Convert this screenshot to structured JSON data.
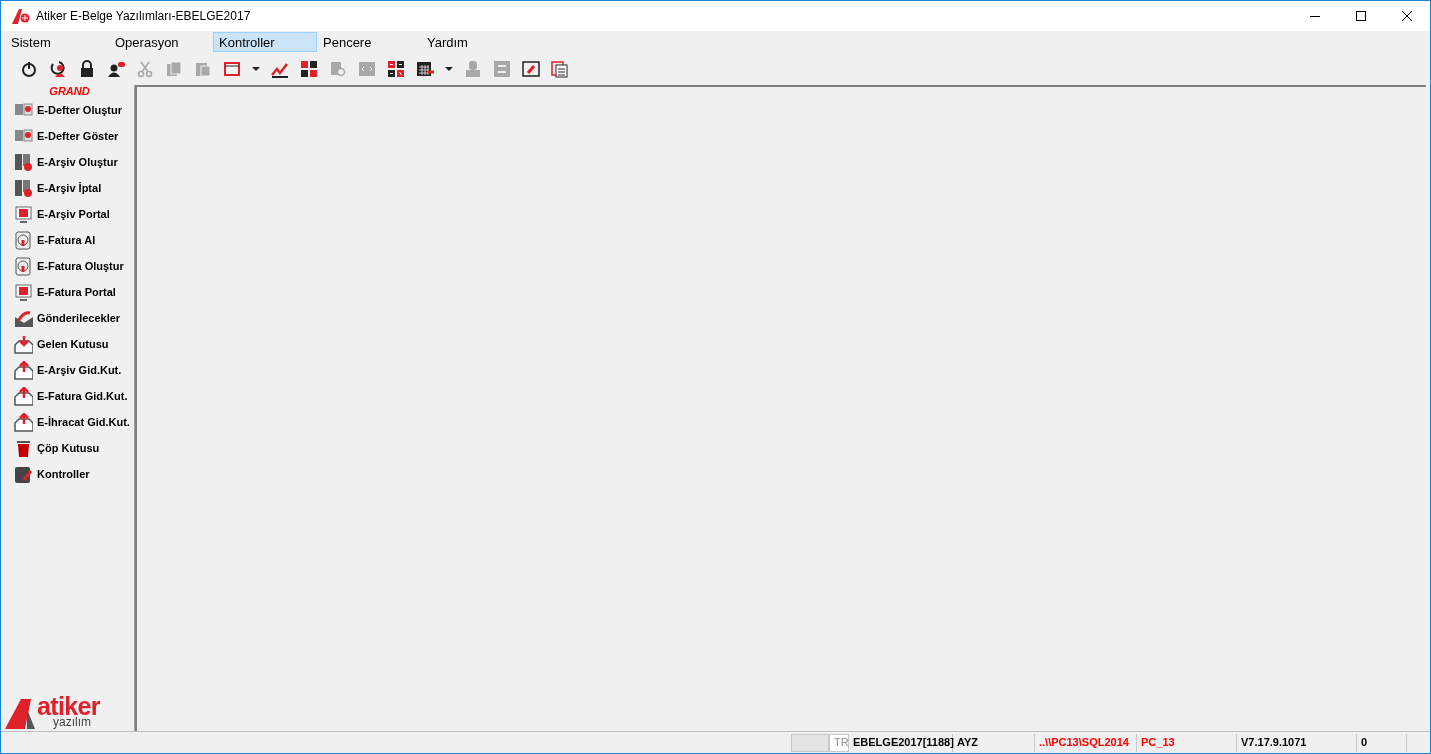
{
  "window": {
    "title": "Atiker E-Belge Yazılımları-EBELGE2017"
  },
  "menu": [
    {
      "label": "Sistem",
      "selected": false
    },
    {
      "label": "Operasyon",
      "selected": false
    },
    {
      "label": "Kontroller",
      "selected": true
    },
    {
      "label": "Pencere",
      "selected": false
    },
    {
      "label": "Yardım",
      "selected": false
    }
  ],
  "toolbar": [
    {
      "kind": "power",
      "disabled": false
    },
    {
      "kind": "logout",
      "disabled": false
    },
    {
      "kind": "lock",
      "disabled": false
    },
    {
      "kind": "user",
      "disabled": false
    },
    {
      "kind": "cut",
      "disabled": true
    },
    {
      "kind": "copy",
      "disabled": true
    },
    {
      "kind": "paste",
      "disabled": true
    },
    {
      "kind": "window",
      "disabled": false
    },
    {
      "kind": "dropdown",
      "disabled": false
    },
    {
      "kind": "chart",
      "disabled": false
    },
    {
      "kind": "tiles",
      "disabled": false
    },
    {
      "kind": "search",
      "disabled": true
    },
    {
      "kind": "code",
      "disabled": true
    },
    {
      "kind": "calc",
      "disabled": false
    },
    {
      "kind": "calendar",
      "disabled": false
    },
    {
      "kind": "dropdown",
      "disabled": false
    },
    {
      "kind": "stamp",
      "disabled": true
    },
    {
      "kind": "swap",
      "disabled": true
    },
    {
      "kind": "edit",
      "disabled": false
    },
    {
      "kind": "clipboard",
      "disabled": false
    }
  ],
  "sidebar": {
    "heading": "GRAND",
    "items": [
      {
        "label": "E-Defter Oluştur",
        "kind": "ledger"
      },
      {
        "label": "E-Defter Göster",
        "kind": "ledger"
      },
      {
        "label": "E-Arşiv Oluştur",
        "kind": "archive"
      },
      {
        "label": "E-Arşiv İptal",
        "kind": "archive"
      },
      {
        "label": "E-Arşiv Portal",
        "kind": "monitor"
      },
      {
        "label": "E-Fatura Al",
        "kind": "globe"
      },
      {
        "label": "E-Fatura Oluştur",
        "kind": "globe"
      },
      {
        "label": "E-Fatura Portal",
        "kind": "monitor"
      },
      {
        "label": "Gönderilecekler",
        "kind": "send"
      },
      {
        "label": "Gelen Kutusu",
        "kind": "inbox"
      },
      {
        "label": "E-Arşiv Gid.Kut.",
        "kind": "outbox"
      },
      {
        "label": "E-Fatura Gid.Kut.",
        "kind": "outbox"
      },
      {
        "label": "E-İhracat Gid.Kut.",
        "kind": "outbox"
      },
      {
        "label": "Çöp Kutusu",
        "kind": "trash"
      },
      {
        "label": "Kontroller",
        "kind": "book"
      }
    ],
    "logo": {
      "name": "atiker",
      "tagline": "yazılım"
    }
  },
  "status_bar": [
    {
      "text": "TR",
      "color": "#8c8c8c"
    },
    {
      "text": "EBELGE2017[1188]",
      "color": "#000000"
    },
    {
      "text": "AYZ",
      "color": "#000000"
    },
    {
      "text": "..\\\\PC13\\SQL2014",
      "color": "#ff0000"
    },
    {
      "text": "PC_13",
      "color": "#ff0000"
    },
    {
      "text": "V7.17.9.1071",
      "color": "#000000"
    },
    {
      "text": "0",
      "color": "#000000"
    }
  ]
}
